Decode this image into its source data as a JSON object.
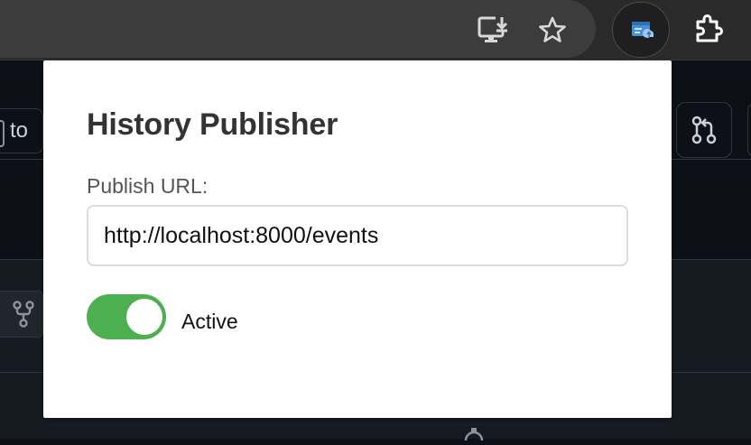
{
  "browser": {
    "toolbar_icons": [
      "install-icon",
      "star-icon",
      "history-publisher-extension-icon",
      "extensions-puzzle-icon"
    ]
  },
  "background_page": {
    "partial_button_text": "to"
  },
  "popup": {
    "title": "History Publisher",
    "url_label": "Publish URL:",
    "url_value": "http://localhost:8000/events",
    "toggle": {
      "label": "Active",
      "on": true,
      "color": "#4caf50"
    }
  },
  "colors": {
    "toolbar": "#2a2a2a",
    "page_bg": "#0d1117",
    "popup_bg": "#ffffff",
    "accent_green": "#4caf50"
  }
}
